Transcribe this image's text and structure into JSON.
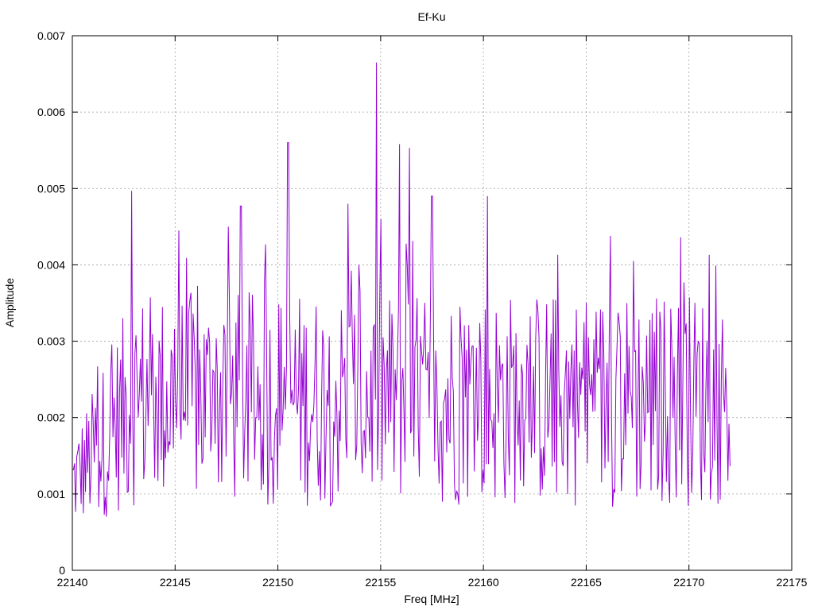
{
  "chart_data": {
    "type": "line",
    "title": "Ef-Ku",
    "xlabel": "Freq [MHz]",
    "ylabel": "Amplitude",
    "xlim": [
      22140,
      22175
    ],
    "ylim": [
      0,
      0.007
    ],
    "grid": true,
    "series_color": "#9400d3",
    "x_ticks": [
      22140,
      22145,
      22150,
      22155,
      22160,
      22165,
      22170,
      22175
    ],
    "x_tick_labels": [
      "22140",
      "22145",
      "22150",
      "22155",
      "22160",
      "22165",
      "22170",
      "22175"
    ],
    "y_ticks": [
      0,
      0.001,
      0.002,
      0.003,
      0.004,
      0.005,
      0.006,
      0.007
    ],
    "y_tick_labels": [
      "0",
      "0.001",
      "0.002",
      "0.003",
      "0.004",
      "0.005",
      "0.006",
      "0.007"
    ],
    "series": [
      {
        "x_start": 22140,
        "x_end": 22172,
        "n_points": 600,
        "noise_level": 0.0018,
        "peaks": [
          {
            "x": 22142.9,
            "y": 0.00497
          },
          {
            "x": 22145.2,
            "y": 0.00445
          },
          {
            "x": 22147.6,
            "y": 0.0045
          },
          {
            "x": 22148.2,
            "y": 0.00477
          },
          {
            "x": 22150.5,
            "y": 0.0056
          },
          {
            "x": 22153.4,
            "y": 0.0048
          },
          {
            "x": 22154.8,
            "y": 0.00665
          },
          {
            "x": 22155.9,
            "y": 0.00558
          },
          {
            "x": 22156.4,
            "y": 0.00553
          },
          {
            "x": 22157.5,
            "y": 0.0049
          },
          {
            "x": 22160.2,
            "y": 0.0049
          },
          {
            "x": 22167.3,
            "y": 0.00405
          },
          {
            "x": 22169.6,
            "y": 0.00436
          },
          {
            "x": 22171.0,
            "y": 0.00413
          }
        ]
      }
    ]
  }
}
